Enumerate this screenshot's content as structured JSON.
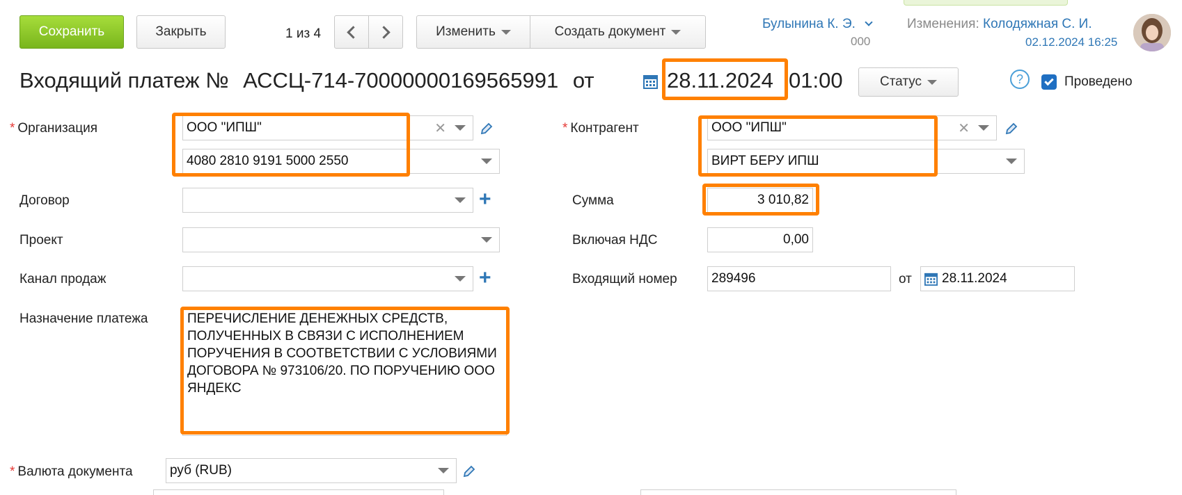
{
  "toolbar": {
    "save_label": "Сохранить",
    "close_label": "Закрыть",
    "pager_text": "1 из 4",
    "edit_label": "Изменить",
    "create_doc_label": "Создать документ"
  },
  "user": {
    "name": "Булынина К. Э.",
    "sub": "000",
    "changes_label": "Изменения:",
    "changes_user": "Колодяжная С. И.",
    "changes_time": "02.12.2024 16:25"
  },
  "header": {
    "title": "Входящий платеж №",
    "number": "АССЦ-714-70000000169565991",
    "from_label": "от",
    "date": "28.11.2024",
    "time": "01:00",
    "status_label": "Статус",
    "help": "?",
    "posted_label": "Проведено",
    "posted_checked": true
  },
  "form": {
    "organization": {
      "label": "Организация",
      "value": "ООО \"ИПШ\"",
      "account": "4080 2810 9191 5000 2550"
    },
    "contract": {
      "label": "Договор",
      "value": ""
    },
    "project": {
      "label": "Проект",
      "value": ""
    },
    "sales_channel": {
      "label": "Канал продаж",
      "value": ""
    },
    "purpose": {
      "label": "Назначение платежа",
      "value": "ПЕРЕЧИСЛЕНИЕ ДЕНЕЖНЫХ СРЕДСТВ, ПОЛУЧЕННЫХ В СВЯЗИ С ИСПОЛНЕНИЕМ ПОРУЧЕНИЯ В СООТВЕТСТВИИ С УСЛОВИЯМИ ДОГОВОРА № 973106/20. ПО ПОРУЧЕНИЮ ООО ЯНДЕКС"
    },
    "currency": {
      "label": "Валюта документа",
      "value": "руб (RUB)"
    },
    "counterparty": {
      "label": "Контрагент",
      "value": "ООО \"ИПШ\"",
      "account": "ВИРТ БЕРУ ИПШ"
    },
    "amount": {
      "label": "Сумма",
      "value": "3 010,82"
    },
    "vat": {
      "label": "Включая НДС",
      "value": "0,00"
    },
    "incoming_number": {
      "label": "Входящий номер",
      "value": "289496",
      "from_label": "от",
      "date": "28.11.2024"
    }
  },
  "colors": {
    "accent_link": "#2f77b6",
    "save_green": "#86c12a",
    "highlight": "#ff8000",
    "required": "#e53935"
  },
  "icons": [
    "chevron-left-icon",
    "chevron-right-icon",
    "calendar-icon",
    "pencil-icon",
    "plus-icon",
    "clear-icon",
    "dropdown-arrow-icon",
    "help-icon",
    "avatar"
  ]
}
